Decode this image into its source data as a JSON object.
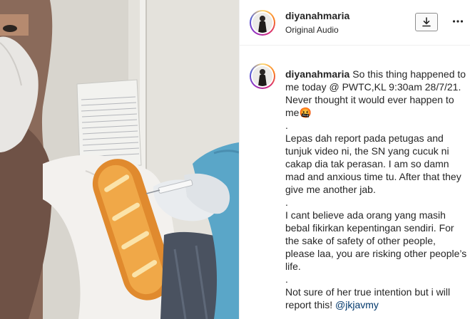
{
  "post": {
    "username": "diyanahmaria",
    "audio": "Original Audio",
    "caption_text": "So this thing happened to me today @ PWTC,KL 9:30am 28/7/21. Never thought it would ever happen to me🤬\n.\nLepas dah report pada petugas and tunjuk video ni, the SN yang cucuk ni cakap dia tak perasan. I am so damn mad and anxious time tu. After that they give me another jab.\n.\nI cant believe ada orang yang masih bebal fikirkan kepentingan sendiri. For the sake of safety of other people, please laa, you are risking other people’s life.\n.\nNot sure of her true intention but i will report this! ",
    "mention": "@jkjavmy"
  },
  "icons": {
    "download": "download-icon",
    "more": "more-options-icon"
  },
  "colors": {
    "accent_mention": "#00376b",
    "text": "#262626",
    "border": "#efefef"
  }
}
